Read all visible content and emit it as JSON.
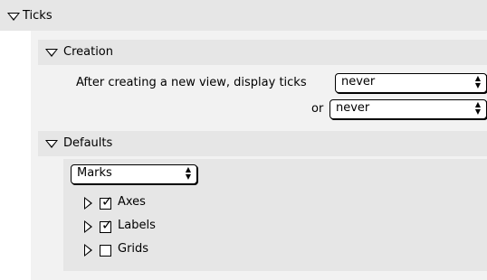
{
  "ticks": {
    "title": "Ticks"
  },
  "creation": {
    "title": "Creation",
    "prompt_label": "After creating a new view, display ticks",
    "or_label": "or",
    "popup1_value": "never",
    "popup2_value": "never"
  },
  "defaults": {
    "title": "Defaults",
    "marks_value": "Marks",
    "items": [
      {
        "label": "Axes",
        "checked": true
      },
      {
        "label": "Labels",
        "checked": true
      },
      {
        "label": "Grids",
        "checked": false
      }
    ]
  }
}
